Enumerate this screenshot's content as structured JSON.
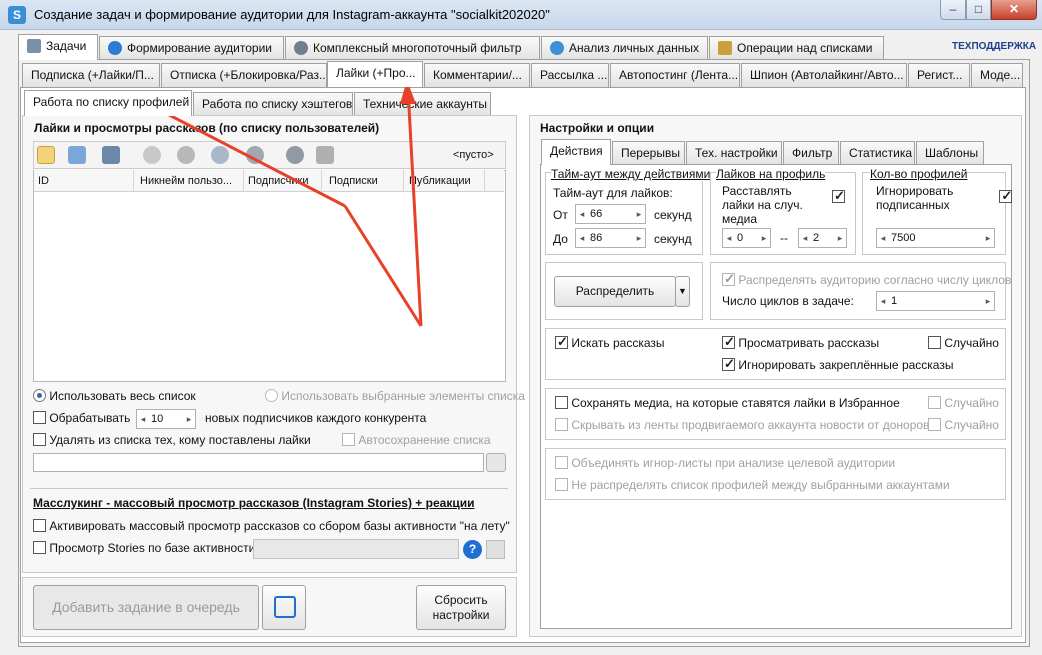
{
  "window": {
    "title": "Создание задач и формирование аудитории для Instagram-аккаунта \"socialkit202020\"",
    "app_icon": "S",
    "minimize": "–",
    "maximize": "□",
    "close": "✕"
  },
  "main_tabs": [
    {
      "label": "Задачи",
      "icon": "tasks-icon"
    },
    {
      "label": "Формирование аудитории",
      "icon": "user-icon"
    },
    {
      "label": "Комплексный многопоточный фильтр",
      "icon": "gear-icon"
    },
    {
      "label": "Анализ личных данных",
      "icon": "users-icon"
    },
    {
      "label": "Операции над списками",
      "icon": "list-icon"
    }
  ],
  "tech_support": "ТЕХПОДДЕРЖКА",
  "task_tabs": [
    "Подписка (+Лайки/П...",
    "Отписка (+Блокировка/Раз...",
    "Лайки (+Про...",
    "Комментарии/...",
    "Рассылка ...",
    "Автопостинг (Лента...",
    "Шпион (Автолайкинг/Авто...",
    "Регист...",
    "Моде..."
  ],
  "sub_tabs": [
    "Работа по списку профилей",
    "Работа по списку хэштегов",
    "Технические аккаунты"
  ],
  "left": {
    "section_title": "Лайки и просмотры рассказов (по списку пользователей)",
    "empty_label": "<пусто>",
    "columns": [
      "ID",
      "Никнейм пользо...",
      "Подписчики",
      "Подписки",
      "Публикации"
    ],
    "use_whole_list": "Использовать весь список",
    "use_selected": "Использовать выбранные элементы списка",
    "process_label": "Обрабатывать",
    "process_value": "10",
    "process_suffix": "новых подписчиков каждого конкурента",
    "remove_liked": "Удалять из списка тех, кому поставлены лайки",
    "autosave": "Автосохранение списка",
    "masslooking_title": "Масслукинг - массовый просмотр рассказов (Instagram Stories) + реакции",
    "activate_mass": "Активировать массовый просмотр рассказов со сбором базы активности \"на лету\"",
    "stories_base": "Просмотр Stories по базе активности:"
  },
  "footer": {
    "add_task": "Добавить задание в очередь",
    "reset_line1": "Сбросить",
    "reset_line2": "настройки"
  },
  "right": {
    "section_title": "Настройки и опции",
    "tabs": [
      "Действия",
      "Перерывы",
      "Тех. настройки",
      "Фильтр",
      "Статистика",
      "Шаблоны"
    ],
    "timeout_title": "Тайм-аут между действиями",
    "timeout_likes": "Тайм-аут для лайков:",
    "from_label": "От",
    "from_value": "66",
    "to_label": "До",
    "to_value": "86",
    "seconds": "секунд",
    "likes_per_profile_title": "Лайков на профиль",
    "random_likes": "Расставлять лайки на случ. медиа",
    "likes_min": "0",
    "likes_dash": "--",
    "likes_max": "2",
    "profiles_count_title": "Кол-во профилей",
    "ignore_subscribed": "Игнорировать подписанных",
    "profiles_value": "7500",
    "distribute_button": "Распределить",
    "distribute_by_cycles": "Распределять аудиторию согласно числу циклов",
    "cycles_label": "Число циклов в задаче:",
    "cycles_value": "1",
    "search_stories": "Искать рассказы",
    "view_stories": "Просматривать рассказы",
    "random1": "Случайно",
    "ignore_pinned": "Игнорировать закреплённые рассказы",
    "save_media": "Сохранять медиа, на которые ставятся лайки в Избранное",
    "random2": "Случайно",
    "hide_news": "Скрывать из ленты продвигаемого аккаунта новости от доноров",
    "random3": "Случайно",
    "merge_ignore": "Объединять игнор-листы при анализе целевой аудитории",
    "no_distribute": "Не распределять список профилей между выбранными аккаунтами"
  },
  "colors": {
    "annotation_arrow": "#e8412a",
    "title_gradient_top": "#dbe6f3",
    "close_button": "#c7412c",
    "tech_support_link": "#1f3f8a"
  }
}
